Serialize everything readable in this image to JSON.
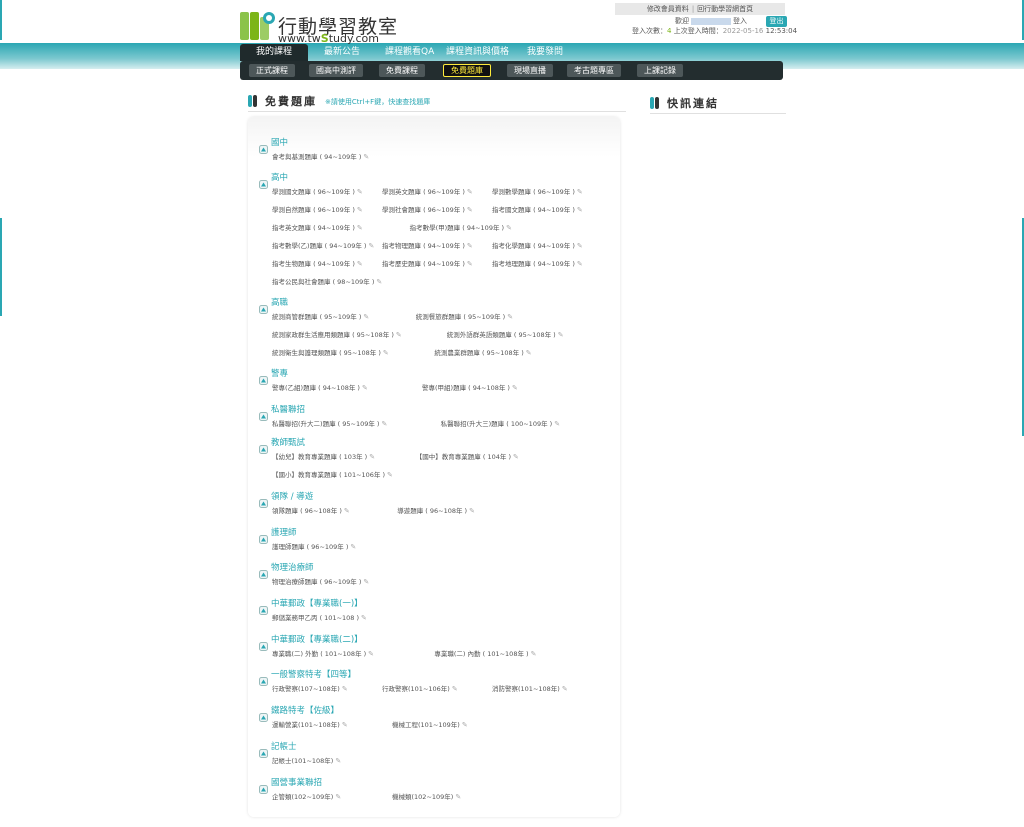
{
  "brand": {
    "name": "行動學習教室",
    "url_pre": "www.tw",
    "url_mid": "S",
    "url_post": "tudy.com",
    "accent": "#2aa7b3",
    "green": "#7cb518"
  },
  "toplinks": {
    "edit_profile": "修改會員資料",
    "sep": "|",
    "homepage": "回行動學習網首頁"
  },
  "user": {
    "welcome_pre": "歡迎",
    "welcome_post": "登入",
    "logout": "登出",
    "login_count_label": "登入次數：",
    "login_count": "4",
    "last_login_label": " 上次登入時間：",
    "last_login_date": "2022-05-16",
    "last_login_time": " 12:53:04"
  },
  "mainnav": [
    "我的課程",
    "最新公告",
    "課程觀看QA",
    "課程資訊與價格",
    "我要發問"
  ],
  "subnav": [
    "正式課程",
    "國高中測評",
    "免費課程",
    "免費題庫",
    "現場直播",
    "考古題專區",
    "上課記錄"
  ],
  "section": {
    "title": "免費題庫",
    "hint": "※請使用Ctrl+F鍵，快速查找題庫"
  },
  "quicklinks": {
    "title": "快訊連結"
  },
  "categories": [
    {
      "title": "國中",
      "rows": [
        [
          "會考與基測題庫 ( 94~109年 )"
        ]
      ]
    },
    {
      "title": "高中",
      "rows": [
        [
          "學測國文題庫 ( 96~109年 )",
          "學測英文題庫 ( 96~109年 )",
          "學測數學題庫 ( 96~109年 )"
        ],
        [
          "學測自然題庫 ( 96~109年 )",
          "學測社會題庫 ( 96~109年 )",
          "指考國文題庫 ( 94~109年 )"
        ],
        [
          "指考英文題庫 ( 94~109年 )",
          "指考數學(甲)題庫 ( 94~109年 )"
        ],
        [
          "指考數學(乙)題庫 ( 94~109年 )",
          "指考物理題庫 ( 94~109年 )",
          "指考化學題庫 ( 94~109年 )"
        ],
        [
          "指考生物題庫 ( 94~109年 )",
          "指考歷史題庫 ( 94~109年 )",
          "指考地理題庫 ( 94~109年 )"
        ],
        [
          "指考公民與社會題庫 ( 98~109年 )"
        ]
      ]
    },
    {
      "title": "高職",
      "rows": [
        [
          "統測商管群題庫 ( 95~109年 )",
          "統測餐旅群題庫 ( 95~109年 )"
        ],
        [
          "統測家政群生活應用類題庫 ( 95~108年 )",
          "統測外語群英語類題庫 ( 95~108年 )"
        ],
        [
          "統測衛生與護理類題庫 ( 95~108年 )",
          "統測農業群題庫 ( 95~108年 )"
        ]
      ]
    },
    {
      "title": "警專",
      "rows": [
        [
          "警專(乙組)題庫 ( 94~108年 )",
          "警專(甲組)題庫 ( 94~108年 )"
        ]
      ]
    },
    {
      "title": "私醫聯招",
      "rows": [
        [
          "私醫聯招(升大二)題庫 ( 95~109年 )",
          "私醫聯招(升大三)題庫 ( 100~109年 )"
        ]
      ]
    },
    {
      "title": "教師甄試",
      "rows": [
        [
          "【幼兒】教育專業題庫 ( 103年 )",
          "【國中】教育專業題庫 ( 104年 )"
        ],
        [
          "【國小】教育專業題庫 ( 101~106年 )"
        ]
      ]
    },
    {
      "title": "領隊 / 導遊",
      "rows": [
        [
          "領隊題庫 ( 96~108年 )",
          "導遊題庫 ( 96~108年 )"
        ]
      ]
    },
    {
      "title": "護理師",
      "rows": [
        [
          "護理師題庫 ( 96~109年 )"
        ]
      ]
    },
    {
      "title": "物理治療師",
      "rows": [
        [
          "物理治療師題庫 ( 96~109年 )"
        ]
      ]
    },
    {
      "title": "中華郵政【專業職(一)】",
      "rows": [
        [
          "郵儲業務甲乙丙 ( 101~108 )"
        ]
      ]
    },
    {
      "title": "中華郵政【專業職(二)】",
      "rows": [
        [
          "專業職(二) 外勤 ( 101~108年 )",
          "專業職(二) 內勤 ( 101~108年 )"
        ]
      ]
    },
    {
      "title": "一般警察特考【四等】",
      "rows": [
        [
          "行政警察(107~108年)",
          "行政警察(101~106年)",
          "消防警察(101~108年)"
        ]
      ]
    },
    {
      "title": "鐵路特考【佐級】",
      "rows": [
        [
          "運輸營業(101~108年)",
          "機械工程(101~109年)"
        ]
      ]
    },
    {
      "title": "記帳士",
      "rows": [
        [
          "記帳士(101~108年)"
        ]
      ]
    },
    {
      "title": "國營事業聯招",
      "rows": [
        [
          "企管類(102~109年)",
          "機械類(102~109年)"
        ]
      ]
    }
  ]
}
